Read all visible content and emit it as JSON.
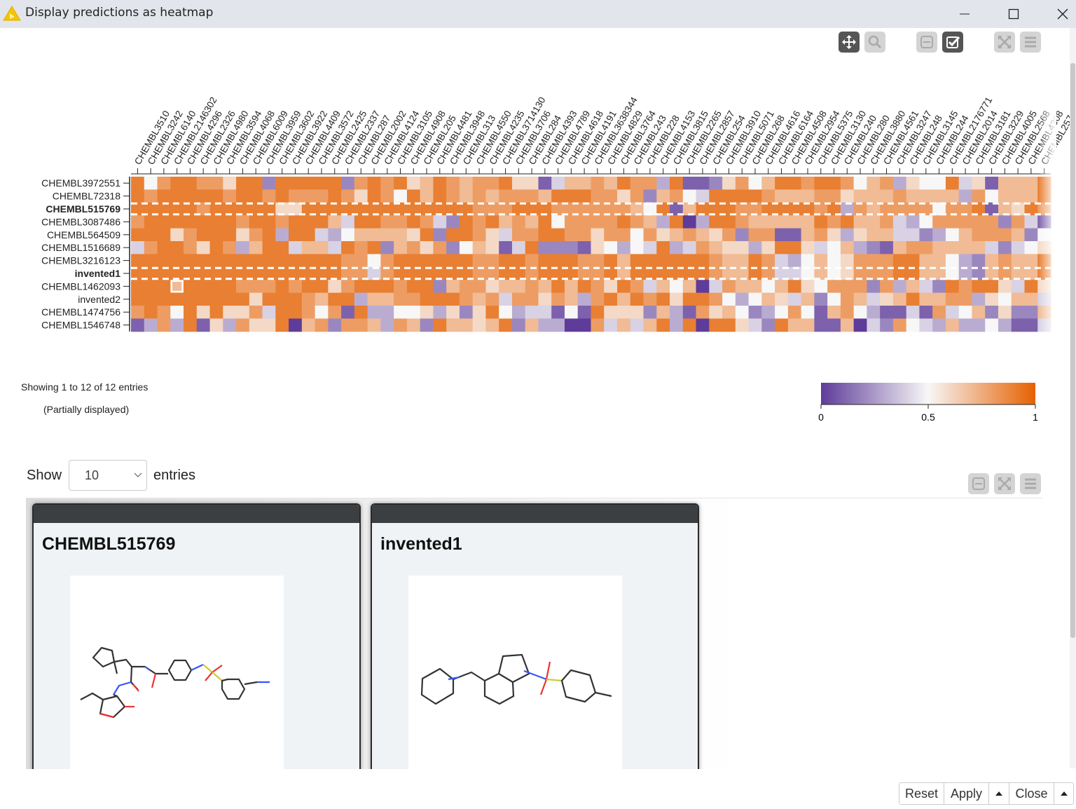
{
  "window": {
    "title": "Display predictions as heatmap",
    "icon": "warning-triangle-icon",
    "controls": [
      "minimize-icon",
      "maximize-icon",
      "close-icon"
    ]
  },
  "toolbar": {
    "buttons": [
      {
        "icon": "pan-move-icon",
        "active": true
      },
      {
        "icon": "zoom-magnifier-icon",
        "active": false
      },
      {
        "icon": "collapse-minus-icon",
        "active": false
      },
      {
        "icon": "selection-checkbox-icon",
        "active": true
      },
      {
        "icon": "fullscreen-expand-icon",
        "active": false
      },
      {
        "icon": "menu-hamburger-icon",
        "active": false
      }
    ]
  },
  "chart_data": {
    "type": "heatmap",
    "colorscale": {
      "min_color": "#5e3c99",
      "mid_color": "#f7f7f7",
      "max_color": "#e66101",
      "range": [
        0,
        1
      ],
      "ticks": [
        "0",
        "0.5",
        "1"
      ]
    },
    "columns": [
      "CHEMBL3510",
      "CHEMBL3242",
      "CHEMBL6140",
      "CHEMBL2146302",
      "CHEMBL4296",
      "CHEMBL2326",
      "CHEMBL4980",
      "CHEMBL3594",
      "CHEMBL4068",
      "CHEMBL6009",
      "CHEMBL3959",
      "CHEMBL3602",
      "CHEMBL3922",
      "CHEMBL4409",
      "CHEMBL3572",
      "CHEMBL2425",
      "CHEMBL2337",
      "CHEMBL287",
      "CHEMBL2002",
      "CHEMBL4124",
      "CHEMBL3105",
      "CHEMBL4908",
      "CHEMBL205",
      "CHEMBL4481",
      "CHEMBL3948",
      "CHEMBL313",
      "CHEMBL4550",
      "CHEMBL4235",
      "CHEMBL3714130",
      "CHEMBL3706",
      "CHEMBL284",
      "CHEMBL4393",
      "CHEMBL4789",
      "CHEMBL4618",
      "CHEMBL4191",
      "CHEMBL3638344",
      "CHEMBL4829",
      "CHEMBL3764",
      "CHEMBL243",
      "CHEMBL228",
      "CHEMBL4153",
      "CHEMBL3815",
      "CHEMBL2265",
      "CHEMBL2857",
      "CHEMBL254",
      "CHEMBL3910",
      "CHEMBL5071",
      "CHEMBL268",
      "CHEMBL4616",
      "CHEMBL6164",
      "CHEMBL4508",
      "CHEMBL2954",
      "CHEMBL5375",
      "CHEMBL3130",
      "CHEMBL240",
      "CHEMBL280",
      "CHEMBL3880",
      "CHEMBL4561",
      "CHEMBL3247",
      "CHEMBL248",
      "CHEMBL3145",
      "CHEMBL244",
      "CHEMBL2176771",
      "CHEMBL2014",
      "CHEMBL3181",
      "CHEMBL3229",
      "CHEMBL4005",
      "CHEMBL2568",
      "CHEMBL4308",
      "CHEMBL257"
    ],
    "rows": [
      {
        "label": "CHEMBL3972551",
        "selected": false,
        "values": [
          0.9,
          0.5,
          0.8,
          0.9,
          0.9,
          0.8,
          0.8,
          0.6,
          0.9,
          0.9,
          0.2,
          0.9,
          0.9,
          0.9,
          0.9,
          0.9,
          0.2,
          0.8,
          0.9,
          0.8,
          0.9,
          0.6,
          0.7,
          0.9,
          0.8,
          0.7,
          0.8,
          0.8,
          0.9,
          0.6,
          0.6,
          0.1,
          0.4,
          0.7,
          0.7,
          0.8,
          0.7,
          0.9,
          0.8,
          0.8,
          0.3,
          0.9,
          0.1,
          0.1,
          0.2,
          0.6,
          0.8,
          0.5,
          0.7,
          0.9,
          0.9,
          0.8,
          0.9,
          0.9,
          0.8,
          0.5,
          0.7,
          0.8,
          0.3,
          0.6,
          0.5,
          0.5,
          0.9,
          0.4,
          0.6,
          0.1,
          0.7,
          0.7,
          0.7,
          0.9
        ]
      },
      {
        "label": "CHEMBL72318",
        "selected": false,
        "values": [
          0.9,
          0.8,
          0.9,
          0.9,
          0.9,
          0.9,
          0.9,
          0.8,
          0.9,
          0.9,
          0.8,
          0.9,
          0.8,
          0.8,
          0.8,
          0.9,
          0.8,
          0.6,
          0.9,
          0.8,
          0.5,
          0.9,
          0.7,
          0.9,
          0.8,
          0.7,
          0.8,
          0.7,
          0.8,
          0.8,
          0.8,
          0.7,
          0.9,
          0.9,
          0.9,
          0.8,
          0.8,
          0.6,
          0.8,
          0.2,
          0.7,
          0.8,
          0.5,
          0.4,
          0.9,
          0.9,
          0.9,
          0.9,
          0.8,
          0.7,
          0.7,
          0.7,
          0.8,
          0.8,
          0.6,
          0.7,
          0.7,
          0.7,
          0.8,
          0.7,
          0.7,
          0.7,
          0.7,
          0.3,
          0.8,
          0.5,
          0.7,
          0.7,
          0.7,
          0.9
        ]
      },
      {
        "label": "CHEMBL515769",
        "selected": true,
        "values": [
          0.9,
          0.9,
          0.9,
          0.9,
          0.9,
          0.8,
          0.9,
          0.9,
          0.9,
          0.9,
          0.9,
          0.6,
          0.6,
          0.9,
          0.9,
          0.9,
          0.9,
          0.9,
          0.9,
          0.9,
          0.9,
          0.9,
          0.9,
          0.9,
          0.9,
          0.9,
          0.8,
          0.8,
          0.8,
          0.9,
          0.9,
          0.9,
          0.8,
          0.8,
          0.8,
          0.8,
          0.8,
          0.8,
          0.7,
          0.5,
          0.9,
          0.1,
          0.7,
          0.9,
          0.9,
          0.9,
          0.8,
          0.8,
          0.9,
          0.9,
          0.9,
          0.9,
          0.8,
          0.9,
          0.3,
          0.8,
          0.7,
          0.8,
          0.8,
          0.8,
          0.8,
          0.5,
          0.8,
          0.8,
          0.9,
          0.1,
          0.7,
          0.6,
          0.9,
          0.8
        ]
      },
      {
        "label": "CHEMBL3087486",
        "selected": false,
        "values": [
          0.8,
          0.9,
          0.9,
          0.9,
          0.9,
          0.9,
          0.9,
          0.9,
          0.8,
          0.9,
          0.9,
          0.8,
          0.9,
          0.9,
          0.9,
          0.7,
          0.4,
          0.9,
          0.9,
          0.8,
          0.8,
          0.9,
          0.8,
          0.4,
          0.2,
          0.9,
          0.8,
          0.9,
          0.7,
          0.8,
          0.7,
          0.9,
          0.5,
          0.8,
          0.8,
          0.8,
          0.8,
          0.9,
          0.8,
          0.7,
          0.3,
          0.9,
          0.0,
          0.3,
          0.9,
          0.9,
          0.8,
          0.7,
          0.7,
          0.7,
          0.7,
          0.7,
          0.9,
          0.8,
          0.9,
          0.7,
          0.7,
          0.8,
          0.4,
          0.3,
          0.5,
          0.8,
          0.8,
          0.8,
          0.8,
          0.8,
          0.2,
          0.8,
          0.4,
          0.1
        ]
      },
      {
        "label": "CHEMBL564509",
        "selected": false,
        "values": [
          0.9,
          0.9,
          0.9,
          0.6,
          0.8,
          0.9,
          0.9,
          0.9,
          0.6,
          0.8,
          0.9,
          0.3,
          0.9,
          0.9,
          0.4,
          0.3,
          0.5,
          0.7,
          0.7,
          0.7,
          0.7,
          0.6,
          0.9,
          0.2,
          0.9,
          0.9,
          0.8,
          0.6,
          0.4,
          0.8,
          0.8,
          0.9,
          0.9,
          0.8,
          0.8,
          0.6,
          0.8,
          0.8,
          0.5,
          0.8,
          0.6,
          0.7,
          0.8,
          0.7,
          0.6,
          0.8,
          0.2,
          0.8,
          0.8,
          0.1,
          0.1,
          0.7,
          0.8,
          0.6,
          0.3,
          0.6,
          0.7,
          0.7,
          0.4,
          0.4,
          0.2,
          0.3,
          0.5,
          0.7,
          0.8,
          0.8,
          0.8,
          0.7,
          0.2,
          0.5
        ]
      },
      {
        "label": "CHEMBL1516689",
        "selected": false,
        "values": [
          0.4,
          0.8,
          0.9,
          0.9,
          0.8,
          0.6,
          0.9,
          0.8,
          0.3,
          0.7,
          0.9,
          0.9,
          0.4,
          0.7,
          0.7,
          0.4,
          0.9,
          0.8,
          0.9,
          0.2,
          0.7,
          0.8,
          0.6,
          0.8,
          0.2,
          0.5,
          0.7,
          0.6,
          0.1,
          0.4,
          0.9,
          0.2,
          0.2,
          0.2,
          0.1,
          0.6,
          0.5,
          0.3,
          0.5,
          0.4,
          0.9,
          0.3,
          0.4,
          0.8,
          0.7,
          0.6,
          0.6,
          0.3,
          0.6,
          0.9,
          0.9,
          0.6,
          0.4,
          0.5,
          0.7,
          0.3,
          0.2,
          0.1,
          0.7,
          0.8,
          0.8,
          0.7,
          0.7,
          0.7,
          0.7,
          0.4,
          0.2,
          0.4,
          0.5,
          0.6
        ]
      },
      {
        "label": "CHEMBL3216123",
        "selected": false,
        "values": [
          0.9,
          0.9,
          0.9,
          0.9,
          0.9,
          0.9,
          0.9,
          0.9,
          0.9,
          0.9,
          0.9,
          0.9,
          0.9,
          0.9,
          0.9,
          0.9,
          0.8,
          0.8,
          0.5,
          0.8,
          0.9,
          0.9,
          0.9,
          0.9,
          0.9,
          0.9,
          0.8,
          0.8,
          0.9,
          0.9,
          0.8,
          0.9,
          0.9,
          0.9,
          0.8,
          0.8,
          0.9,
          0.7,
          0.9,
          0.9,
          0.9,
          0.9,
          0.9,
          0.9,
          0.8,
          0.7,
          0.7,
          0.9,
          0.8,
          0.4,
          0.3,
          0.5,
          0.7,
          0.5,
          0.6,
          0.8,
          0.8,
          0.8,
          0.9,
          0.9,
          0.7,
          0.7,
          0.5,
          0.3,
          0.2,
          0.7,
          0.8,
          0.7,
          0.7,
          0.9
        ]
      },
      {
        "label": "invented1",
        "selected": true,
        "values": [
          0.9,
          0.9,
          0.9,
          0.9,
          0.9,
          0.9,
          0.9,
          0.9,
          0.9,
          0.9,
          0.9,
          0.9,
          0.9,
          0.9,
          0.9,
          0.9,
          0.8,
          0.8,
          0.4,
          0.8,
          0.9,
          0.9,
          0.9,
          0.9,
          0.9,
          0.9,
          0.8,
          0.8,
          0.9,
          0.9,
          0.8,
          0.9,
          0.9,
          0.9,
          0.8,
          0.8,
          0.9,
          0.7,
          0.9,
          0.9,
          0.9,
          0.9,
          0.9,
          0.9,
          0.8,
          0.7,
          0.7,
          0.9,
          0.8,
          0.4,
          0.4,
          0.5,
          0.7,
          0.5,
          0.6,
          0.8,
          0.8,
          0.8,
          0.9,
          0.9,
          0.7,
          0.7,
          0.5,
          0.3,
          0.2,
          0.7,
          0.8,
          0.7,
          0.7,
          0.9
        ]
      },
      {
        "label": "CHEMBL1462093",
        "selected": false,
        "values": [
          0.9,
          0.9,
          0.9,
          0.7,
          0.9,
          0.9,
          0.9,
          0.9,
          0.8,
          0.8,
          0.8,
          0.9,
          0.8,
          0.9,
          0.9,
          0.6,
          0.8,
          0.9,
          0.9,
          0.9,
          0.8,
          0.9,
          0.9,
          0.2,
          0.7,
          0.8,
          0.8,
          0.6,
          0.7,
          0.7,
          0.8,
          0.7,
          0.9,
          0.7,
          0.9,
          0.8,
          0.6,
          0.9,
          0.8,
          0.4,
          0.7,
          0.5,
          0.7,
          0.0,
          0.4,
          0.8,
          0.7,
          0.7,
          0.5,
          0.7,
          0.9,
          0.6,
          0.5,
          0.8,
          0.8,
          0.8,
          0.2,
          0.8,
          0.3,
          0.7,
          0.4,
          0.2,
          0.9,
          0.8,
          0.9,
          0.9,
          0.6,
          0.4,
          0.9,
          0.6
        ]
      },
      {
        "label": "invented2",
        "selected": false,
        "values": [
          0.9,
          0.9,
          0.9,
          0.9,
          0.9,
          0.9,
          0.9,
          0.9,
          0.9,
          0.6,
          0.9,
          0.9,
          0.9,
          0.8,
          0.7,
          0.9,
          0.9,
          0.3,
          0.7,
          0.7,
          0.8,
          0.8,
          0.9,
          0.9,
          0.9,
          0.8,
          0.7,
          0.8,
          0.4,
          0.8,
          0.8,
          0.6,
          0.8,
          0.7,
          0.3,
          0.8,
          0.9,
          0.7,
          0.9,
          0.8,
          0.9,
          0.6,
          0.9,
          0.9,
          0.8,
          0.5,
          0.3,
          0.5,
          0.7,
          0.6,
          0.4,
          0.7,
          0.2,
          0.5,
          0.8,
          0.7,
          0.4,
          0.6,
          0.7,
          0.9,
          0.7,
          0.7,
          0.8,
          0.8,
          0.3,
          0.6,
          0.5,
          0.7,
          0.7,
          0.4
        ]
      },
      {
        "label": "CHEMBL1474756",
        "selected": false,
        "values": [
          0.8,
          0.9,
          0.8,
          0.5,
          0.9,
          0.6,
          0.9,
          0.6,
          0.6,
          0.8,
          0.4,
          0.9,
          0.9,
          0.8,
          0.5,
          0.8,
          0.1,
          0.9,
          0.3,
          0.3,
          0.5,
          0.5,
          0.6,
          0.3,
          0.6,
          0.2,
          0.6,
          0.9,
          0.5,
          0.3,
          0.4,
          0.4,
          0.1,
          0.5,
          0.1,
          0.9,
          0.6,
          0.6,
          0.6,
          0.2,
          0.7,
          0.3,
          0.1,
          0.8,
          0.6,
          0.7,
          0.5,
          0.2,
          0.3,
          0.5,
          0.8,
          0.5,
          0.1,
          0.7,
          0.8,
          0.5,
          0.3,
          0.1,
          0.1,
          0.4,
          0.1,
          0.8,
          0.4,
          0.5,
          0.7,
          0.2,
          0.6,
          0.2,
          0.2,
          0.7
        ]
      },
      {
        "label": "CHEMBL1546748",
        "selected": false,
        "values": [
          0.1,
          0.3,
          0.8,
          0.3,
          0.9,
          0.1,
          0.6,
          0.3,
          0.8,
          0.6,
          0.6,
          0.9,
          0.0,
          0.7,
          0.8,
          0.2,
          0.8,
          0.8,
          0.7,
          0.3,
          0.8,
          0.7,
          0.2,
          0.9,
          0.7,
          0.7,
          0.6,
          0.7,
          0.9,
          0.2,
          0.7,
          0.3,
          0.3,
          0.0,
          0.0,
          0.8,
          0.4,
          0.7,
          0.4,
          0.7,
          0.9,
          0.3,
          0.9,
          0.0,
          0.9,
          0.9,
          0.6,
          0.4,
          0.2,
          0.9,
          0.7,
          0.7,
          0.1,
          0.1,
          0.7,
          0.0,
          0.4,
          0.2,
          0.8,
          0.5,
          0.4,
          0.3,
          0.7,
          0.3,
          0.3,
          0.5,
          0.3,
          0.1,
          0.1,
          0.4
        ]
      }
    ],
    "highlighted_cell": {
      "row": "CHEMBL1462093",
      "column": "CHEMBL2146302"
    }
  },
  "summary": {
    "showing": "Showing 1 to 12 of 12 entries",
    "partial": "(Partially displayed)"
  },
  "legend": {
    "ticks": [
      "0",
      "0.5",
      "1"
    ]
  },
  "entries": {
    "show_label": "Show",
    "selected": "10",
    "entries_label": "entries"
  },
  "tile_toolbar": {
    "buttons": [
      "collapse-minus-icon",
      "fullscreen-expand-icon",
      "menu-hamburger-icon"
    ]
  },
  "tiles": [
    {
      "title": "CHEMBL515769",
      "structure": "molecule-structure-1"
    },
    {
      "title": "invented1",
      "structure": "molecule-structure-2"
    }
  ],
  "footer": {
    "reset": "Reset",
    "apply": "Apply",
    "close": "Close"
  }
}
